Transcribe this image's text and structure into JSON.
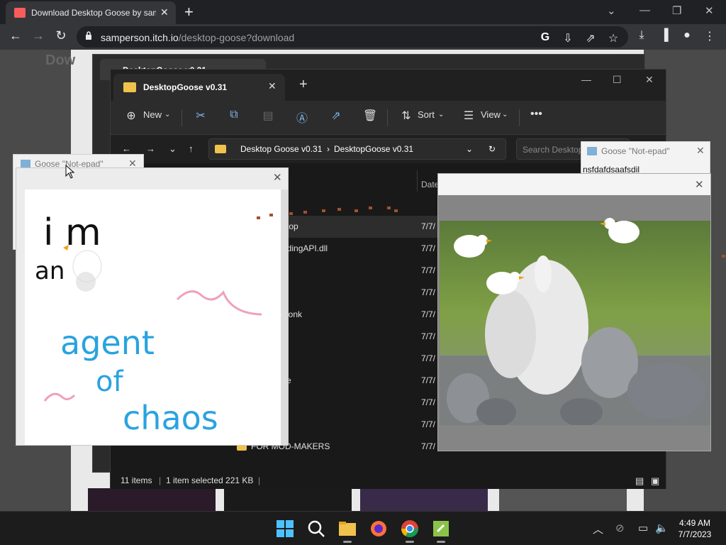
{
  "browser": {
    "tab_title": "Download Desktop Goose by samperson",
    "url_host": "samperson.itch.io",
    "url_path": "/desktop-goose?download",
    "page_heading": "Dow"
  },
  "explorer_back": {
    "tab_title": "DesktopGoose v0.31"
  },
  "explorer": {
    "tab_title": "DesktopGoose v0.31",
    "commands": {
      "new": "New",
      "sort": "Sort",
      "view": "View"
    },
    "breadcrumb": [
      "Desktop Goose v0.31",
      "DesktopGoose v0.31"
    ],
    "search_placeholder": "Search Desktop",
    "column_date": "Date",
    "files": [
      {
        "name": "ktop",
        "date": "7/7/"
      },
      {
        "name": "ddingAPI.dll",
        "date": "7/7/"
      },
      {
        "name": "",
        "date": "7/7/"
      },
      {
        "name": "",
        "date": "7/7/"
      },
      {
        "name": "Honk",
        "date": "7/7/"
      },
      {
        "name": "",
        "date": "7/7/"
      },
      {
        "name": "g",
        "date": "7/7/"
      },
      {
        "name": "se",
        "date": "7/7/"
      },
      {
        "name": "",
        "date": "7/7/"
      },
      {
        "name": "",
        "date": "7/7/"
      },
      {
        "name": "FOR MOD-MAKERS",
        "date": "7/7/"
      }
    ],
    "status": {
      "items": "11 items",
      "selected": "1 item selected  221 KB"
    }
  },
  "notepad_right": {
    "title": "Goose \"Not-epad\"",
    "text": "nsfdafdsaafsdil"
  },
  "notepad_left": {
    "title": "Goose \"Not-epad\""
  },
  "drawing": {
    "words": [
      "i m",
      "an",
      "agent",
      "of",
      "chaos"
    ]
  },
  "taskbar": {
    "time": "4:49 AM",
    "date": "7/7/2023"
  },
  "colors": {
    "chrome_bg": "#202124",
    "explorer_bg": "#191919",
    "folder": "#f0c24d",
    "ink_blue": "#29a3e0",
    "ink_pink": "#f0a0b8"
  }
}
